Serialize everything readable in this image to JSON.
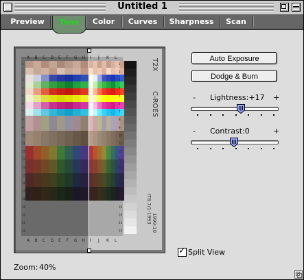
{
  "window": {
    "title": "Untitled 1"
  },
  "tabs": [
    {
      "label": "Preview",
      "selected": false
    },
    {
      "label": "Tone",
      "selected": true
    },
    {
      "label": "Color",
      "selected": false
    },
    {
      "label": "Curves",
      "selected": false
    },
    {
      "label": "Sharpness",
      "selected": false
    },
    {
      "label": "Scan",
      "selected": false
    }
  ],
  "buttons": {
    "auto_exposure": "Auto Exposure",
    "dodge_burn": "Dodge & Burn"
  },
  "lightness": {
    "label": "Lightness:",
    "value": "+17",
    "minus": "-",
    "plus": "+",
    "fraction": 0.58
  },
  "contrast": {
    "label": "Contrast:",
    "value": "0",
    "minus": "-",
    "plus": "+",
    "fraction": 0.5
  },
  "split_view": {
    "label": "Split View",
    "checked": true
  },
  "zoom": {
    "label": "Zoom:",
    "value": "40%"
  },
  "preview": {
    "column_letters": [
      "A",
      "B",
      "C",
      "D",
      "E",
      "F",
      "G",
      "H",
      "I",
      "J",
      "K",
      "L"
    ],
    "row_numbers": [
      "1",
      "2",
      "3",
      "4",
      "5",
      "6",
      "7",
      "8",
      "9",
      "10",
      "11",
      "12",
      "13",
      "14",
      "15",
      "16",
      "17",
      "18",
      "19",
      "20",
      "21",
      "22"
    ],
    "brand": "C-ROES",
    "code": "T2X",
    "target_id": "IT8.7/1-1993",
    "date": "1999:10"
  },
  "colors": {
    "tab_selected_text": "#22d422",
    "tab_bar": "#666666"
  }
}
